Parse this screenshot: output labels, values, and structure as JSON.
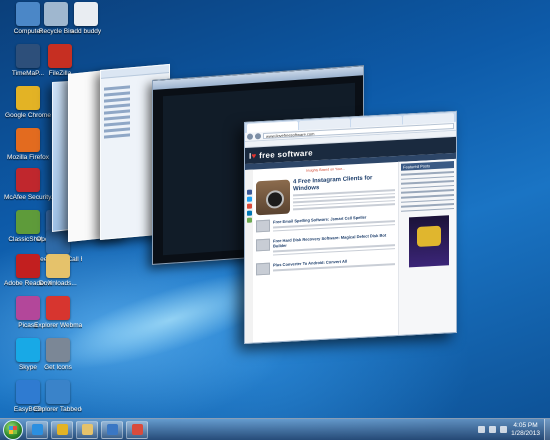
{
  "desktop": {
    "icons": [
      {
        "label": "Computer",
        "icon": "computer-icon",
        "color": "#4b87c7"
      },
      {
        "label": "Recycle Bin",
        "icon": "recycle-bin-icon",
        "color": "#9fb7cf"
      },
      {
        "label": "add buddy",
        "icon": "document-icon",
        "color": "#e9edf2"
      },
      {
        "label": "TimeMaP...",
        "icon": "monitor-icon",
        "color": "#2d4f7a"
      },
      {
        "label": "FileZilla",
        "icon": "filezilla-icon",
        "color": "#c62f22"
      },
      {
        "label": "Google Chrome",
        "icon": "chrome-icon",
        "color": "#e3b325"
      },
      {
        "label": "Mozilla Firefox",
        "icon": "firefox-icon",
        "color": "#e36b1f"
      },
      {
        "label": "McAfee Security...",
        "icon": "mcafee-icon",
        "color": "#c0272d"
      },
      {
        "label": "ClassicShel...",
        "icon": "shell-icon",
        "color": "#5e9b3a"
      },
      {
        "label": "OpenOffice 4...",
        "icon": "openoffice-icon",
        "color": "#3a6fb0"
      },
      {
        "label": "Free Video Call Recorder...",
        "icon": "video-recorder-icon",
        "color": "#2e6aa8"
      },
      {
        "label": "Adobe Reader XI",
        "icon": "adobe-reader-icon",
        "color": "#c21f1f"
      },
      {
        "label": "Downloads...",
        "icon": "folder-icon",
        "color": "#e5c26b"
      },
      {
        "label": "Picasa",
        "icon": "picasa-icon",
        "color": "#b3479a"
      },
      {
        "label": "Explorer Webmaster",
        "icon": "tools-icon",
        "color": "#d7352f"
      },
      {
        "label": "Skype",
        "icon": "skype-icon",
        "color": "#18a9e6"
      },
      {
        "label": "Get Icons",
        "icon": "gear-icon",
        "color": "#7b8796"
      },
      {
        "label": "EasyBCD",
        "icon": "windows-flag-icon",
        "color": "#2f7bd1"
      },
      {
        "label": "Explorer Tabbedd...",
        "icon": "explorer-icon",
        "color": "#3a83c9"
      }
    ]
  },
  "browser": {
    "url": "www.ilovefreesoftware.com",
    "site_logo_prefix": "I",
    "site_logo_dot": "♥",
    "site_logo_main": "free software",
    "promo": "Insights Based on Your...",
    "feature_title": "4 Free Instagram Clients for Windows",
    "post_titles": [
      "Free Email Spelling Software: Jsmart Cell Speller",
      "Free Hard Disk Recovery Software: Magical Defect Disk Bot Builder",
      "Plus Converter To Android: Convert All"
    ],
    "sidebar_title": "Featured Posts"
  },
  "taskbar": {
    "pinned": [
      {
        "name": "internet-explorer",
        "icon": "ie-icon",
        "color": "#2b8fe0"
      },
      {
        "name": "chrome",
        "icon": "chrome-icon",
        "color": "#e3b325"
      },
      {
        "name": "explorer",
        "icon": "folder-icon",
        "color": "#e5c26b"
      },
      {
        "name": "media-player",
        "icon": "media-player-icon",
        "color": "#3a77c4"
      },
      {
        "name": "snipping",
        "icon": "snipping-tool-icon",
        "color": "#d94b3c"
      }
    ],
    "clock_time": "4:05 PM",
    "clock_date": "1/28/2013"
  }
}
